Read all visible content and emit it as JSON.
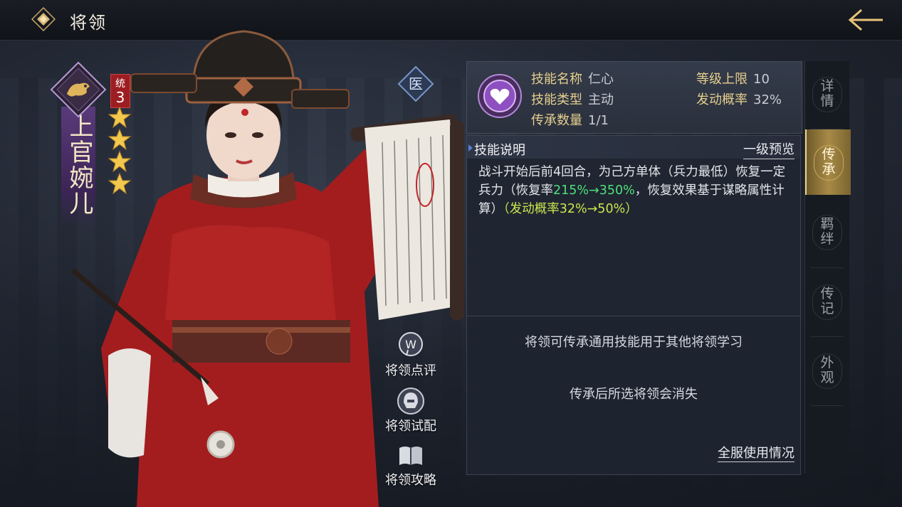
{
  "header": {
    "title": "将领"
  },
  "hero": {
    "name": "上官婉儿",
    "command_label": "统",
    "command_value": "3",
    "stars": 4,
    "class_label": "医"
  },
  "actions": [
    {
      "label": "将领点评",
      "icon": "comment-icon"
    },
    {
      "label": "将领试配",
      "icon": "helmet-icon"
    },
    {
      "label": "将领攻略",
      "icon": "book-icon"
    }
  ],
  "skill": {
    "name_label": "技能名称",
    "name_value": "仁心",
    "type_label": "技能类型",
    "type_value": "主动",
    "count_label": "传承数量",
    "count_value": "1/1",
    "level_label": "等级上限",
    "level_value": "10",
    "rate_label": "发动概率",
    "rate_value": "32%"
  },
  "description": {
    "title": "技能说明",
    "preview_link": "一级预览",
    "text_1": "战斗开始后前4回合，为己方单体（兵力最低）恢复一定兵力（恢复率",
    "hl_1": "215%→350%",
    "text_2": "，恢复效果基于谋略属性计算）",
    "hl_2": "（发动概率32%→50%）"
  },
  "info": {
    "line_1": "将领可传承通用技能用于其他将领学习",
    "line_2": "传承后所选将领会消失",
    "server_link": "全服使用情况"
  },
  "tabs": [
    {
      "label": "详情",
      "active": false
    },
    {
      "label": "传承",
      "active": true
    },
    {
      "label": "羁绊",
      "active": false
    },
    {
      "label": "传记",
      "active": false
    },
    {
      "label": "外观",
      "active": false
    }
  ],
  "colors": {
    "accent_gold": "#e6cf8e",
    "highlight_green": "#4ee07a",
    "highlight_yellow": "#c8e84e",
    "command_red": "#9d1e22",
    "active_tab": "#a88a46"
  }
}
